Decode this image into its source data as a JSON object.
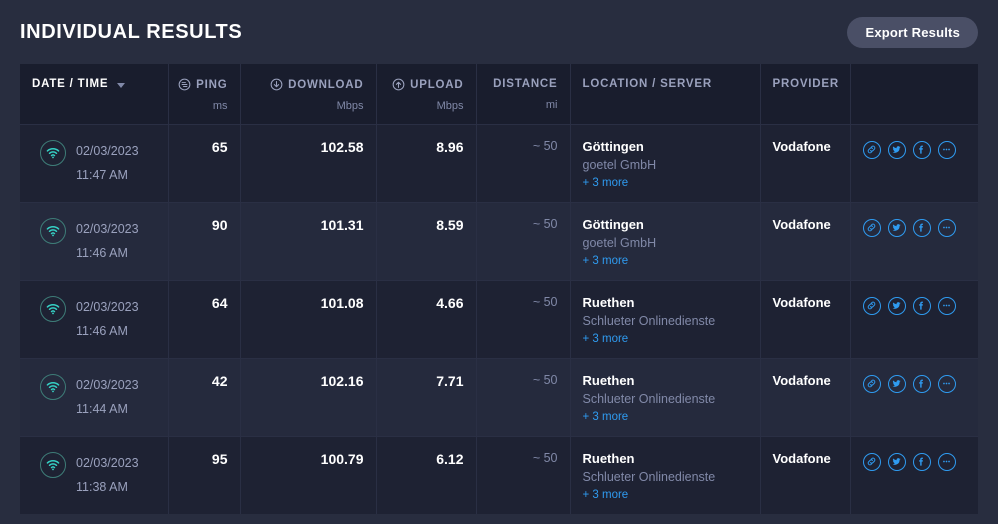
{
  "header": {
    "title": "INDIVIDUAL RESULTS",
    "export_label": "Export Results"
  },
  "colors": {
    "page_bg": "#282d3f",
    "header_row_bg": "#191d2d",
    "row_odd_bg": "#1e2233",
    "row_even_bg": "#252a3d",
    "grid_line": "#2a2f44",
    "accent_link": "#2f9bf0",
    "wifi_teal": "#35d0c4",
    "muted_text": "#8189a8",
    "header_text": "#9aa1bd",
    "export_btn_bg": "#4a4f66"
  },
  "table": {
    "columns": [
      {
        "key": "date",
        "label": "DATE / TIME",
        "unit": "",
        "icon": "",
        "align": "left",
        "sorted": true,
        "sort_caret": "▼"
      },
      {
        "key": "ping",
        "label": "PING",
        "unit": "ms",
        "icon": "ping-icon",
        "align": "right",
        "sorted": false,
        "sort_caret": ""
      },
      {
        "key": "download",
        "label": "DOWNLOAD",
        "unit": "Mbps",
        "icon": "download-icon",
        "align": "right",
        "sorted": false,
        "sort_caret": ""
      },
      {
        "key": "upload",
        "label": "UPLOAD",
        "unit": "Mbps",
        "icon": "upload-icon",
        "align": "right",
        "sorted": false,
        "sort_caret": ""
      },
      {
        "key": "distance",
        "label": "DISTANCE",
        "unit": "mi",
        "icon": "",
        "align": "right",
        "sorted": false,
        "sort_caret": ""
      },
      {
        "key": "location",
        "label": "LOCATION / SERVER",
        "unit": "",
        "icon": "",
        "align": "left",
        "sorted": false,
        "sort_caret": ""
      },
      {
        "key": "provider",
        "label": "PROVIDER",
        "unit": "",
        "icon": "",
        "align": "left",
        "sorted": false,
        "sort_caret": ""
      },
      {
        "key": "actions",
        "label": "",
        "unit": "",
        "icon": "",
        "align": "left",
        "sorted": false,
        "sort_caret": ""
      }
    ],
    "action_icons": [
      "link-icon",
      "twitter-icon",
      "facebook-icon",
      "more-icon"
    ],
    "connection_icon": "wifi-icon",
    "rows": [
      {
        "date": "02/03/2023",
        "time": "11:47 AM",
        "ping": "65",
        "download": "102.58",
        "upload": "8.96",
        "distance": "~ 50",
        "city": "Göttingen",
        "server": "goetel GmbH",
        "more": "+ 3 more",
        "provider": "Vodafone"
      },
      {
        "date": "02/03/2023",
        "time": "11:46 AM",
        "ping": "90",
        "download": "101.31",
        "upload": "8.59",
        "distance": "~ 50",
        "city": "Göttingen",
        "server": "goetel GmbH",
        "more": "+ 3 more",
        "provider": "Vodafone"
      },
      {
        "date": "02/03/2023",
        "time": "11:46 AM",
        "ping": "64",
        "download": "101.08",
        "upload": "4.66",
        "distance": "~ 50",
        "city": "Ruethen",
        "server": "Schlueter Onlinedienste",
        "more": "+ 3 more",
        "provider": "Vodafone"
      },
      {
        "date": "02/03/2023",
        "time": "11:44 AM",
        "ping": "42",
        "download": "102.16",
        "upload": "7.71",
        "distance": "~ 50",
        "city": "Ruethen",
        "server": "Schlueter Onlinedienste",
        "more": "+ 3 more",
        "provider": "Vodafone"
      },
      {
        "date": "02/03/2023",
        "time": "11:38 AM",
        "ping": "95",
        "download": "100.79",
        "upload": "6.12",
        "distance": "~ 50",
        "city": "Ruethen",
        "server": "Schlueter Onlinedienste",
        "more": "+ 3 more",
        "provider": "Vodafone"
      }
    ]
  }
}
